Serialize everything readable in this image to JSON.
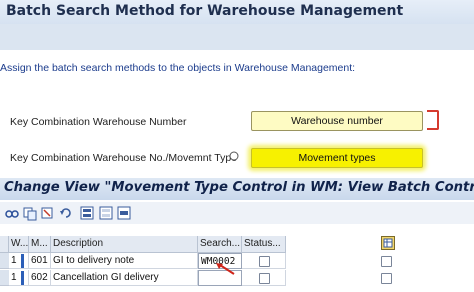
{
  "header": {
    "title": "Batch Search Method for Warehouse Management"
  },
  "instruction": "Assign the batch search methods to the objects in Warehouse Management:",
  "rows": [
    {
      "label": "Key Combination Warehouse Number",
      "button": "Warehouse number"
    },
    {
      "label": "Key Combination Warehouse No./Movemnt Type",
      "button": "Movement types"
    }
  ],
  "change_view": {
    "title": "Change View \"Movement Type Control in WM: View Batch Control\"."
  },
  "toolbar": {
    "icons": [
      "glasses-icon",
      "copy-icon",
      "delete-icon",
      "undo-icon",
      "select-all-icon",
      "deselect-all-icon",
      "select-block-icon"
    ]
  },
  "table": {
    "columns": [
      "W...",
      "M...",
      "Description",
      "Search...",
      "Status..."
    ],
    "rows": [
      {
        "w": "1",
        "m": "601",
        "description": "GI to delivery note",
        "search": "WM0002",
        "status": false
      },
      {
        "w": "1",
        "m": "602",
        "description": "Cancellation GI delivery",
        "search": "",
        "status": false
      }
    ]
  },
  "colors": {
    "highlight": "#f7f100",
    "button_bg": "#fefbc3",
    "title_text": "#1f2f4f",
    "instruction_text": "#1c3c8c",
    "required_bracket": "#d53a2e"
  }
}
